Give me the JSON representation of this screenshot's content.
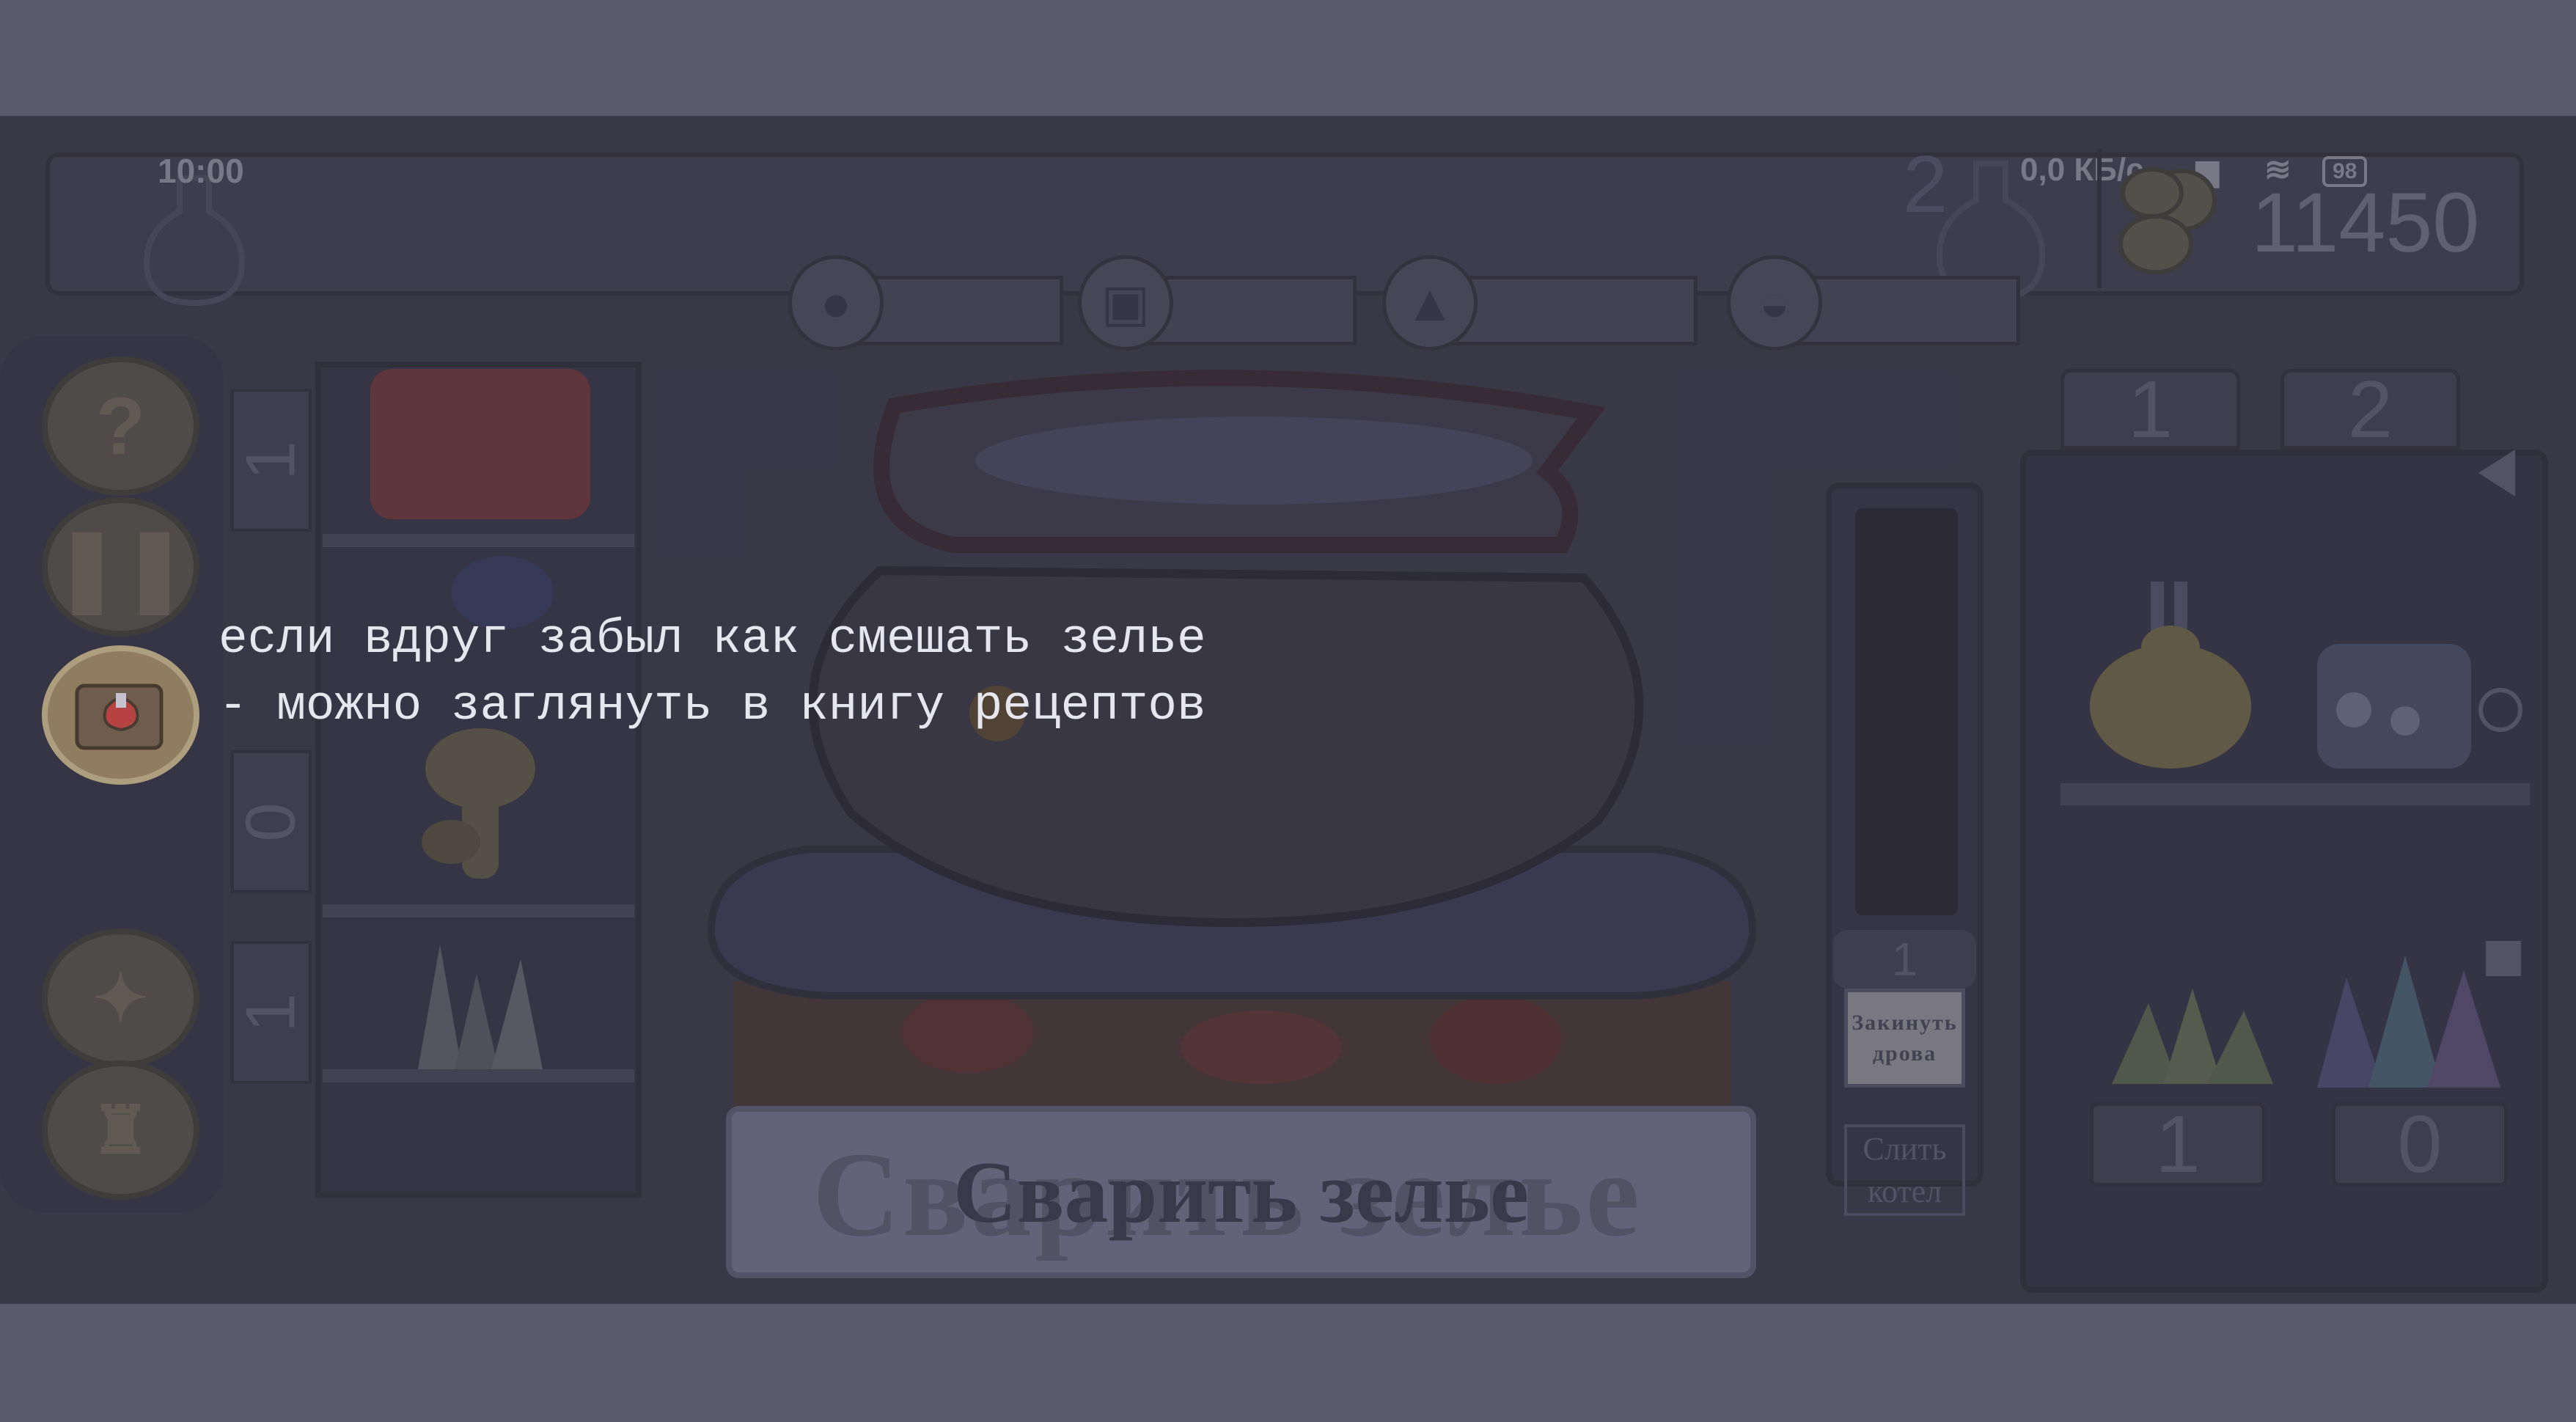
{
  "status_bar": {
    "time": "10:00",
    "network": "0,0 КБ/с",
    "battery": "98"
  },
  "header": {
    "potions_count": "2",
    "coins": "11450"
  },
  "left_shelf": {
    "counts": [
      "1",
      "0",
      "1"
    ]
  },
  "fire": {
    "wood_count": "1",
    "add_wood_label_1": "Закинуть",
    "add_wood_label_2": "дрова"
  },
  "drain": {
    "label_1": "Слить",
    "label_2": "котел"
  },
  "brew_button": {
    "label": "Сварить зелье"
  },
  "right_shelf": {
    "tabs": [
      "1",
      "2"
    ],
    "bottom_counts": [
      "1",
      "0"
    ]
  },
  "tutorial": {
    "line1": "если вдруг забыл как смешать зелье",
    "line2": "- можно заглянуть в книгу рецептов"
  },
  "icons": [
    "help-icon",
    "pause-icon",
    "recipe-book-icon",
    "map-icon",
    "bag-icon",
    "coins-icon",
    "flask-icon"
  ]
}
